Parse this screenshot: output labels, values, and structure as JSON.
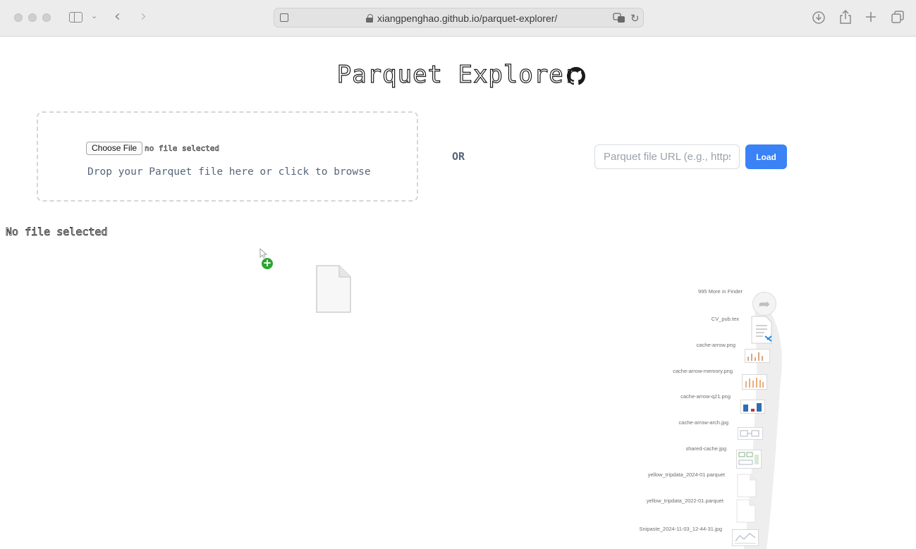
{
  "browser": {
    "url": "xiangpenghao.github.io/parquet-explorer/"
  },
  "header": {
    "title": "Parquet Explorer"
  },
  "upload": {
    "choose_file_label": "Choose File",
    "no_file_inline": "no file selected",
    "drop_hint": "Drop your Parquet file here or click to browse"
  },
  "divider": {
    "or_label": "OR"
  },
  "url_loader": {
    "placeholder": "Parquet file URL (e.g., https://...)",
    "load_label": "Load"
  },
  "status": {
    "text": "No file selected"
  },
  "downloads_stack": {
    "items": [
      {
        "label": "995 More in Finder",
        "icon": "arrow-forward-icon"
      },
      {
        "label": "CV_pub.tex",
        "icon": "tex-file-icon"
      },
      {
        "label": "cache-arrow.png",
        "icon": "image-thumb-icon"
      },
      {
        "label": "cache-arrow-memory.png",
        "icon": "image-thumb-icon"
      },
      {
        "label": "cache-arrow-q21.png",
        "icon": "image-thumb-icon"
      },
      {
        "label": "cache-arrow-arch.jpg",
        "icon": "image-thumb-icon"
      },
      {
        "label": "shared-cache.jpg",
        "icon": "image-thumb-icon"
      },
      {
        "label": "yellow_tripdata_2024-01.parquet",
        "icon": "file-icon"
      },
      {
        "label": "yellow_tripdata_2022-01.parquet",
        "icon": "file-icon"
      },
      {
        "label": "Snipaste_2024-11-03_12-44-31.jpg",
        "icon": "image-thumb-icon"
      }
    ]
  },
  "colors": {
    "accent": "#3b82f6",
    "muted_text": "#56657a",
    "add_badge": "#2ba632"
  }
}
